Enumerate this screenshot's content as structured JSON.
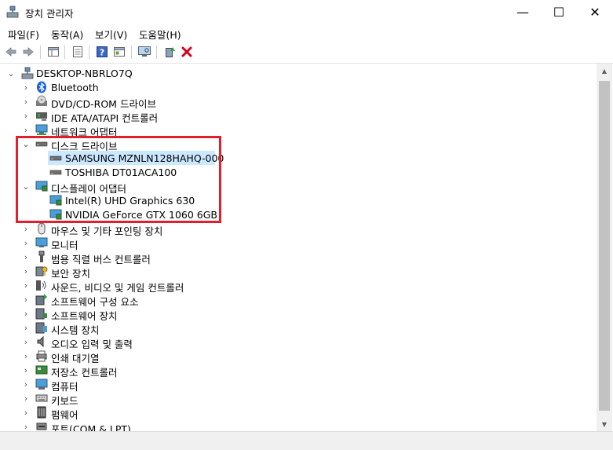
{
  "window": {
    "title": "장치 관리자",
    "minimize": "—",
    "maximize": "☐",
    "close": "✕"
  },
  "menu": [
    "파일(F)",
    "동작(A)",
    "보기(V)",
    "도움말(H)"
  ],
  "toolbar": [
    "back-icon",
    "forward-icon",
    "properties-pane-icon",
    "list-view-icon",
    "help-icon",
    "details-view-icon",
    "monitor-scan-icon",
    "update-driver-icon",
    "uninstall-icon"
  ],
  "tree": {
    "root": "DESKTOP-NBRLO7Q",
    "categories": [
      {
        "label": "Bluetooth",
        "icon": "bluetooth-icon",
        "expanded": false
      },
      {
        "label": "DVD/CD-ROM 드라이브",
        "icon": "dvd-drive-icon",
        "expanded": false
      },
      {
        "label": "IDE ATA/ATAPI 컨트롤러",
        "icon": "ide-controller-icon",
        "expanded": false
      },
      {
        "label": "네트워크 어댑터",
        "icon": "network-adapter-icon",
        "expanded": false
      },
      {
        "label": "디스크 드라이브",
        "icon": "disk-drive-icon",
        "expanded": true,
        "children": [
          {
            "label": "SAMSUNG MZNLN128HAHQ-000",
            "icon": "disk-drive-icon",
            "selected": true
          },
          {
            "label": "TOSHIBA DT01ACA100",
            "icon": "disk-drive-icon",
            "selected": false
          }
        ]
      },
      {
        "label": "디스플레이 어댑터",
        "icon": "display-adapter-icon",
        "expanded": true,
        "children": [
          {
            "label": "Intel(R) UHD Graphics 630",
            "icon": "display-adapter-icon",
            "selected": false
          },
          {
            "label": "NVIDIA GeForce GTX 1060 6GB",
            "icon": "display-adapter-icon",
            "selected": false
          }
        ]
      },
      {
        "label": "마우스 및 기타 포인팅 장치",
        "icon": "mouse-icon",
        "expanded": false
      },
      {
        "label": "모니터",
        "icon": "monitor-icon",
        "expanded": false
      },
      {
        "label": "범용 직렬 버스 컨트롤러",
        "icon": "usb-icon",
        "expanded": false
      },
      {
        "label": "보안 장치",
        "icon": "security-device-icon",
        "expanded": false
      },
      {
        "label": "사운드, 비디오 및 게임 컨트롤러",
        "icon": "sound-icon",
        "expanded": false
      },
      {
        "label": "소프트웨어 구성 요소",
        "icon": "software-component-icon",
        "expanded": false
      },
      {
        "label": "소프트웨어 장치",
        "icon": "software-device-icon",
        "expanded": false
      },
      {
        "label": "시스템 장치",
        "icon": "system-device-icon",
        "expanded": false
      },
      {
        "label": "오디오 입력 및 출력",
        "icon": "audio-io-icon",
        "expanded": false
      },
      {
        "label": "인쇄 대기열",
        "icon": "print-queue-icon",
        "expanded": false
      },
      {
        "label": "저장소 컨트롤러",
        "icon": "storage-controller-icon",
        "expanded": false
      },
      {
        "label": "컴퓨터",
        "icon": "computer-icon",
        "expanded": false
      },
      {
        "label": "키보드",
        "icon": "keyboard-icon",
        "expanded": false
      },
      {
        "label": "펌웨어",
        "icon": "firmware-icon",
        "expanded": false
      },
      {
        "label": "포트(COM & LPT)",
        "icon": "port-icon",
        "expanded": false
      }
    ]
  },
  "colors": {
    "selection": "#cce8ff",
    "annotation_box": "#e0202e",
    "uninstall": "#d0021b"
  }
}
